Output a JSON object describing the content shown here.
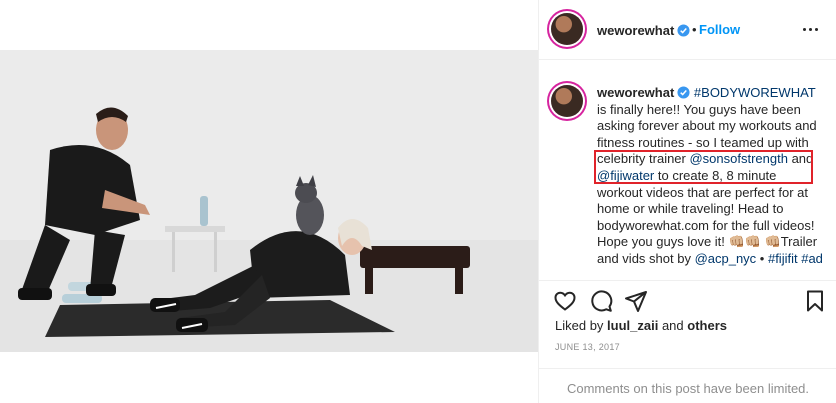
{
  "post": {
    "author": "weworewhat",
    "follow_dot": "•",
    "follow_label": "Follow",
    "caption": {
      "user": "weworewhat",
      "hashtag_main": "#BODYWOREWHAT",
      "t1": " is finally here!! You guys have been asking forever about my workouts and fitness routines - so I teamed up with celebrity trainer ",
      "mention_trainer": "@sonsofstrength",
      "t2": " and ",
      "mention_water": "@fijiwater",
      "t3": " to create 8, 8 minute workout videos that are perfect for at home or while traveling! Head to bodyworewhat.com for the full videos! Hope you guys love it! 👊🏼👊🏼 👊🏼Trailer and vids shot by ",
      "mention_shooter": "@acp_nyc",
      "t4": " • ",
      "hashtag_fiji": "#fijifit",
      "t5": " ",
      "hashtag_ad": "#ad"
    },
    "likes": {
      "prefix": "Liked by ",
      "user": "luul_zaii",
      "mid": " and ",
      "others": "others"
    },
    "date": "JUNE 13, 2017",
    "comments_limited": "Comments on this post have been limited."
  },
  "icons": {
    "verified": "verified-badge-icon",
    "like": "heart-icon",
    "comment": "comment-icon",
    "share": "share-icon",
    "save": "bookmark-icon",
    "mute": "muted-speaker-icon",
    "more": "more-options-icon"
  },
  "colors": {
    "link": "#00376b",
    "follow": "#0095f6",
    "verified": "#3897f0",
    "highlight_box": "#e0232a",
    "muted_text": "#8e8e8e"
  }
}
